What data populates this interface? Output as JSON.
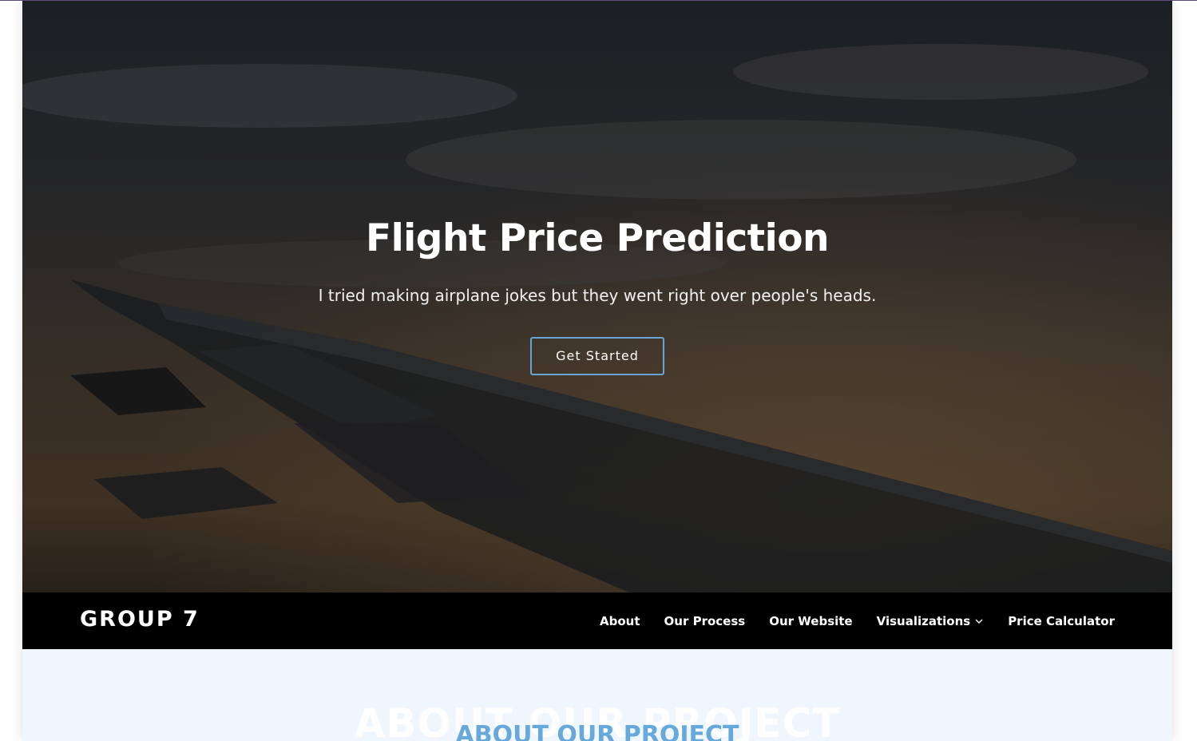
{
  "hero": {
    "title": "Flight Price Prediction",
    "subtitle": "I tried making airplane jokes but they went right over people's heads.",
    "cta_label": "Get Started"
  },
  "navbar": {
    "logo": "GROUP 7",
    "items": [
      {
        "label": "About"
      },
      {
        "label": "Our Process"
      },
      {
        "label": "Our Website"
      },
      {
        "label": "Visualizations",
        "icon": "chevron-down-icon"
      },
      {
        "label": "Price Calculator"
      }
    ]
  },
  "about": {
    "background_title": "ABOUT OUR PROJECT",
    "title": "ABOUT OUR PROJECT"
  },
  "colors": {
    "accent": "#68a9db",
    "navbar_bg": "#000000",
    "section_bg": "#f0f6fd"
  }
}
